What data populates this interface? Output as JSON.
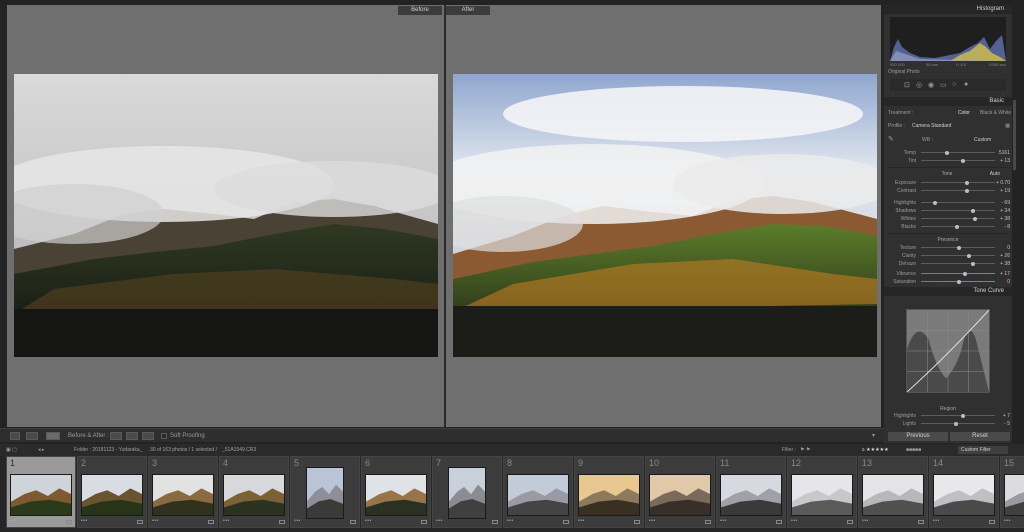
{
  "compare": {
    "before_label": "Before",
    "after_label": "After"
  },
  "toolbar": {
    "mode_label": "Before & After :",
    "soft_proofing": "Soft Proofing"
  },
  "panel": {
    "histogram_title": "Histogram",
    "histogram_info": [
      "ISO 200",
      "55 mm",
      "f / 8.0",
      "1/250 sec"
    ],
    "original_photo": "Original Photo",
    "basic_title": "Basic",
    "treatment_label": "Treatment :",
    "treatment_color": "Color",
    "treatment_bw": "Black & White",
    "profile_label": "Profile :",
    "profile_value": "Camera Standard",
    "wb_label": "WB :",
    "wb_value": "Custom",
    "temp": {
      "label": "Temp",
      "value": "5161"
    },
    "tint": {
      "label": "Tint",
      "value": "+ 13"
    },
    "tone_label": "Tone",
    "auto_label": "Auto",
    "exposure": {
      "label": "Exposure",
      "value": "+ 0.70"
    },
    "contrast": {
      "label": "Contrast",
      "value": "+ 19"
    },
    "highlights": {
      "label": "Highlights",
      "value": "- 69"
    },
    "shadows": {
      "label": "Shadows",
      "value": "+ 34"
    },
    "whites": {
      "label": "Whites",
      "value": "+ 38"
    },
    "blacks": {
      "label": "Blacks",
      "value": "- 8"
    },
    "presence_label": "Presence",
    "texture": {
      "label": "Texture",
      "value": "0"
    },
    "clarity": {
      "label": "Clarity",
      "value": "+ 26"
    },
    "dehaze": {
      "label": "Dehaze",
      "value": "+ 38"
    },
    "vibrance": {
      "label": "Vibrance",
      "value": "+ 17"
    },
    "saturation": {
      "label": "Saturation",
      "value": "0"
    },
    "tone_curve_title": "Tone Curve",
    "region_label": "Region",
    "curve_highlights": {
      "label": "Highlights",
      "value": "+ 7"
    },
    "curve_lights": {
      "label": "Lights",
      "value": "- 5"
    },
    "previous_button": "Previous",
    "reset_button": "Reset"
  },
  "filmstrip_header": {
    "source": "Folder : 20181123 - Yudaraka_",
    "count": "30 of 163 photos / 1 selected /",
    "filename": "_51A1549.CR3",
    "filter_label": "Filter :",
    "filter_value": "Custom Filter"
  },
  "filmstrip": {
    "numbers": [
      "1",
      "2",
      "3",
      "4",
      "5",
      "6",
      "7",
      "8",
      "9",
      "10",
      "11",
      "12",
      "13",
      "14",
      "15"
    ],
    "stars": "•••"
  },
  "colors": {
    "accent": "#e2e2e2",
    "panel_bg": "#303030",
    "canvas_bg": "#6f6f6f"
  }
}
